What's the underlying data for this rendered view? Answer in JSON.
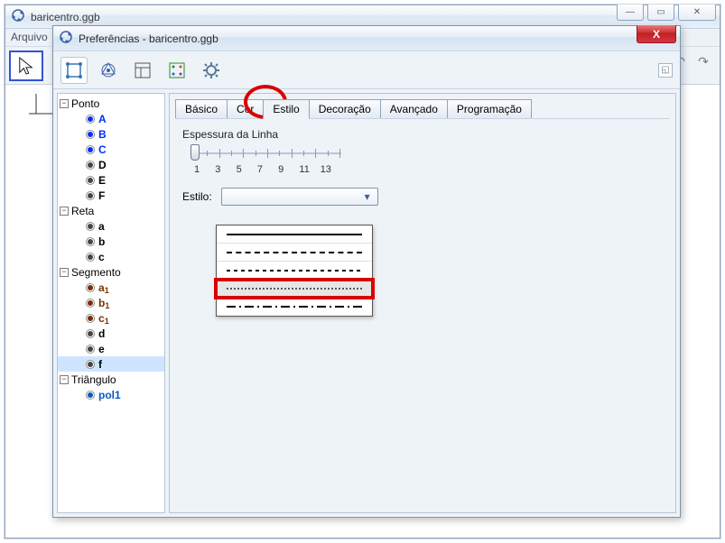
{
  "main_window": {
    "title": "baricentro.ggb",
    "menu_first": "Arquivo"
  },
  "dialog": {
    "title": "Preferências - baricentro.ggb",
    "tabs": [
      "Básico",
      "Cor",
      "Estilo",
      "Decoração",
      "Avançado",
      "Programação"
    ],
    "active_tab_index": 2,
    "thickness_label": "Espessura da Linha",
    "thickness_ticks": [
      "1",
      "3",
      "5",
      "7",
      "9",
      "11",
      "13"
    ],
    "thickness_value": 1,
    "style_label": "Estilo:",
    "style_options": [
      "solid",
      "long-dash",
      "short-dash",
      "dotted",
      "dash-dot"
    ],
    "style_selected_index": 3
  },
  "tree": {
    "categories": [
      {
        "name": "Ponto",
        "items": [
          {
            "label": "A",
            "color": "blue"
          },
          {
            "label": "B",
            "color": "blue"
          },
          {
            "label": "C",
            "color": "blue"
          },
          {
            "label": "D",
            "color": "black"
          },
          {
            "label": "E",
            "color": "black"
          },
          {
            "label": "F",
            "color": "black"
          }
        ]
      },
      {
        "name": "Reta",
        "items": [
          {
            "label": "a",
            "color": "black"
          },
          {
            "label": "b",
            "color": "black"
          },
          {
            "label": "c",
            "color": "black"
          }
        ]
      },
      {
        "name": "Segmento",
        "items": [
          {
            "label": "a1",
            "color": "darkred",
            "sub": true
          },
          {
            "label": "b1",
            "color": "darkred",
            "sub": true
          },
          {
            "label": "c1",
            "color": "darkred",
            "sub": true
          },
          {
            "label": "d",
            "color": "black"
          },
          {
            "label": "e",
            "color": "black"
          },
          {
            "label": "f",
            "color": "black",
            "selected": true
          }
        ]
      },
      {
        "name": "Triângulo",
        "items": [
          {
            "label": "pol1",
            "color": "lightblue"
          }
        ]
      }
    ]
  }
}
